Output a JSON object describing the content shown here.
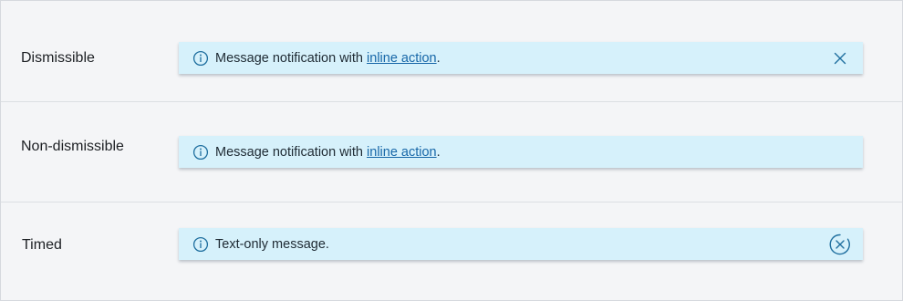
{
  "rows": [
    {
      "label": "Dismissible",
      "message": {
        "before": "Message notification with ",
        "link": "inline action",
        "after": "."
      },
      "control": "close-icon"
    },
    {
      "label": "Non-dismissible",
      "message": {
        "before": "Message notification with ",
        "link": "inline action",
        "after": "."
      },
      "control": null
    },
    {
      "label": "Timed",
      "message": {
        "text": "Text-only message."
      },
      "control": "timed-close-icon"
    }
  ],
  "colors": {
    "notification_bg": "#d6f1fb",
    "accent": "#1767a8",
    "icon": "#1f6f9f"
  }
}
